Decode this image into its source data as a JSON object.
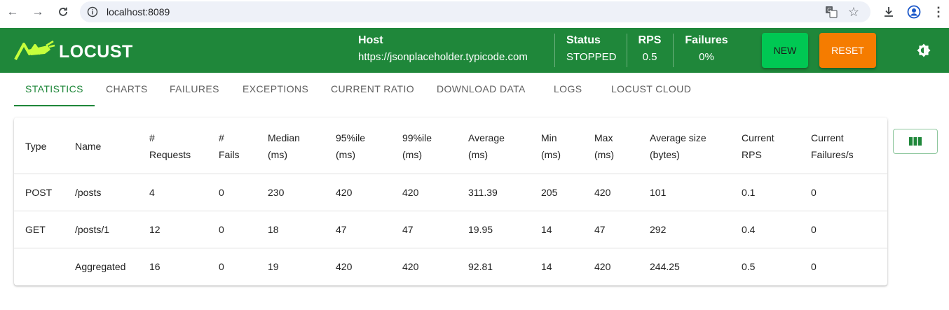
{
  "browser": {
    "url": "localhost:8089"
  },
  "header": {
    "brand": "LOCUST",
    "host_label": "Host",
    "host_value": "https://jsonplaceholder.typicode.com",
    "status_label": "Status",
    "status_value": "STOPPED",
    "rps_label": "RPS",
    "rps_value": "0.5",
    "failures_label": "Failures",
    "failures_value": "0%",
    "new_label": "NEW",
    "reset_label": "RESET"
  },
  "tabs": [
    {
      "label": "STATISTICS",
      "active": true
    },
    {
      "label": "CHARTS"
    },
    {
      "label": "FAILURES"
    },
    {
      "label": "EXCEPTIONS"
    },
    {
      "label": "CURRENT RATIO"
    },
    {
      "label": "DOWNLOAD DATA"
    },
    {
      "label": "LOGS"
    },
    {
      "label": "LOCUST CLOUD"
    }
  ],
  "table": {
    "headers": [
      [
        "Type"
      ],
      [
        "Name"
      ],
      [
        "#",
        "Requests"
      ],
      [
        "#",
        "Fails"
      ],
      [
        "Median",
        "(ms)"
      ],
      [
        "95%ile",
        "(ms)"
      ],
      [
        "99%ile",
        "(ms)"
      ],
      [
        "Average",
        "(ms)"
      ],
      [
        "Min",
        "(ms)"
      ],
      [
        "Max",
        "(ms)"
      ],
      [
        "Average size",
        "(bytes)"
      ],
      [
        "Current",
        "RPS"
      ],
      [
        "Current",
        "Failures/s"
      ]
    ],
    "rows": [
      [
        "POST",
        "/posts",
        "4",
        "0",
        "230",
        "420",
        "420",
        "311.39",
        "205",
        "420",
        "101",
        "0.1",
        "0"
      ],
      [
        "GET",
        "/posts/1",
        "12",
        "0",
        "18",
        "47",
        "47",
        "19.95",
        "14",
        "47",
        "292",
        "0.4",
        "0"
      ],
      [
        "",
        "Aggregated",
        "16",
        "0",
        "19",
        "420",
        "420",
        "92.81",
        "14",
        "420",
        "244.25",
        "0.5",
        "0"
      ]
    ]
  },
  "colors": {
    "brand_green": "#1f873a",
    "new_button": "#00c853",
    "reset_button": "#f57c00"
  }
}
